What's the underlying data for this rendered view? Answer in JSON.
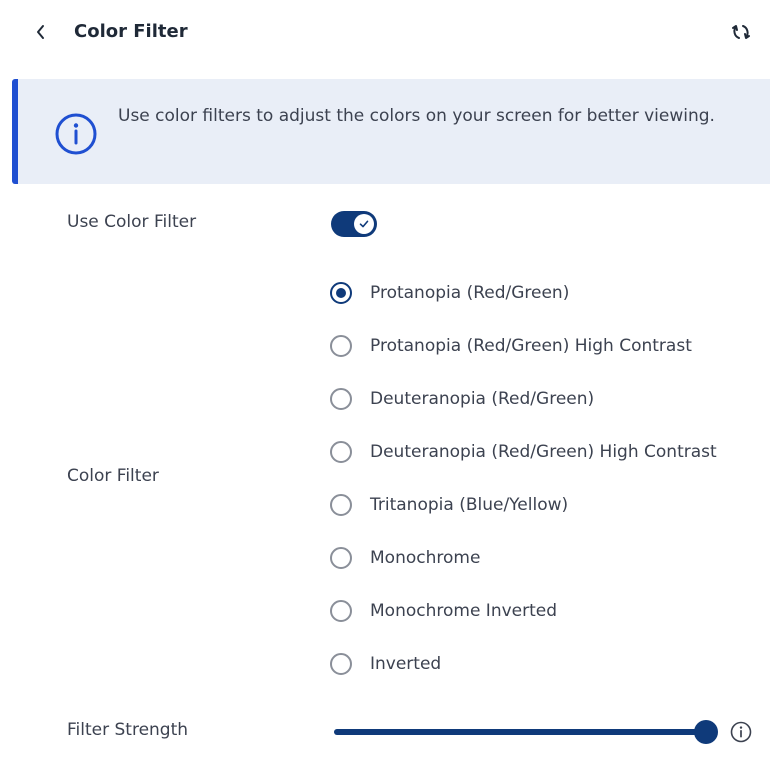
{
  "header": {
    "title": "Color Filter",
    "back_icon": "chevron-left-icon",
    "reset_icon": "reset-icon"
  },
  "info_banner": {
    "icon": "info-icon",
    "text": "Use color filters to adjust the colors on your screen for better viewing.",
    "accent": "#1f4fd1",
    "background": "#e9eef7"
  },
  "use_color_filter": {
    "label": "Use Color Filter",
    "enabled": true
  },
  "color_filter": {
    "label": "Color Filter",
    "selected": "Protanopia (Red/Green)",
    "options": [
      "Protanopia (Red/Green)",
      "Protanopia (Red/Green) High Contrast",
      "Deuteranopia (Red/Green)",
      "Deuteranopia (Red/Green) High Contrast",
      "Tritanopia (Blue/Yellow)",
      "Monochrome",
      "Monochrome Inverted",
      "Inverted"
    ]
  },
  "filter_strength": {
    "label": "Filter Strength",
    "value": 1.0,
    "info_icon": "info-icon"
  },
  "colors": {
    "primary": "#0f3a7a",
    "text": "#3c4250"
  }
}
